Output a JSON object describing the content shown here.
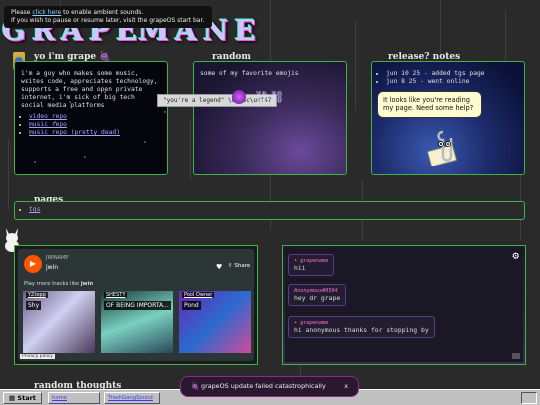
{
  "notice": {
    "line1_prefix": "Please ",
    "link": "click here",
    "line1_suffix": " to enable ambient sounds.",
    "line2": "If you wish to pause or resume later, visit the grapeOS start bar."
  },
  "about": {
    "heading": "yo i'm grape 🍇",
    "body": "i'm a guy who makes some music, writes code, appreciates technology, supports a free and open private internet, i'm sick of big tech social media platforms",
    "links": [
      "video repo",
      "music repo",
      "music repo (pretty dead)"
    ]
  },
  "random": {
    "heading": "random",
    "subtitle": "some of my favorite emojis",
    "badge": "\"you're a legend\"",
    "chain": "⛓⛓"
  },
  "release": {
    "heading": "release? notes",
    "items": [
      "jun 10 25 - added tgs page",
      "jun 8 25 - went online"
    ],
    "clippy": "It looks like you're reading my page. Need some help?"
  },
  "pages": {
    "heading": "pages",
    "items": [
      "tgs"
    ]
  },
  "player": {
    "artist_small": "JWINAMP",
    "artist": "jwin",
    "share": "Share",
    "play_more_prefix": "Play more tracks like ",
    "play_more_artist": "jwin",
    "tracks": [
      {
        "label": "YZtopp",
        "name": "Shy"
      },
      {
        "label": "SHESTY",
        "name": "OF BEING IMPORTA..."
      },
      {
        "label": "Pool Owner",
        "name": "Pond"
      }
    ],
    "privacy": "Privacy policy"
  },
  "chat": {
    "messages": [
      {
        "user": "grapename",
        "text": "hii"
      },
      {
        "user": "Anonymous#8504",
        "text": "hey dr grape"
      },
      {
        "user": "grapename",
        "text": "hi anonymous thanks for stopping by"
      }
    ]
  },
  "bottom_section": "random thoughts",
  "taskbar": {
    "start": "Start",
    "tasks": [
      "home",
      "TrashGangSound"
    ]
  },
  "toast": {
    "text": "grapeOS update failed catastrophically",
    "close": "x"
  },
  "colors": {
    "panel_border": "#3fb24a",
    "toast_border": "#8a2a8a",
    "accent_pink": "#ff6fd8",
    "soundcloud_orange": "#ff5500"
  }
}
